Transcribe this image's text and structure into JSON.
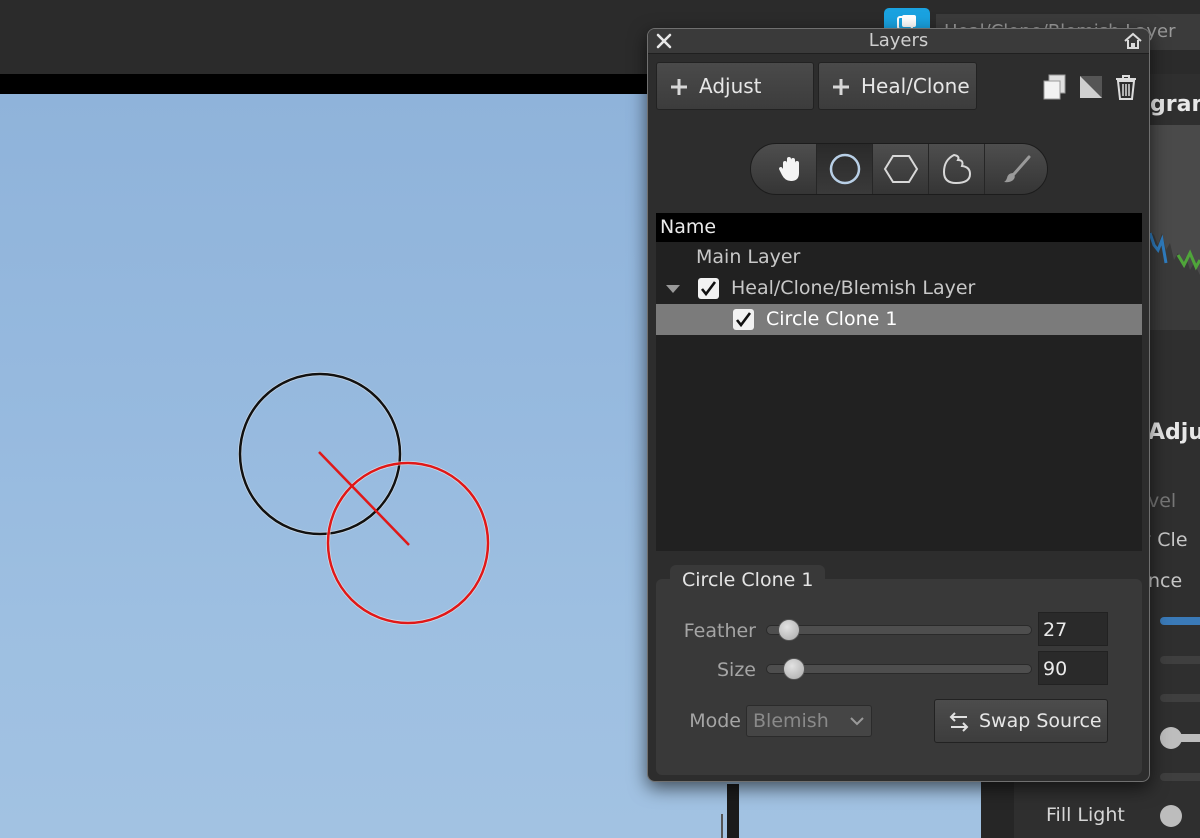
{
  "background": {
    "title_partial": "Heal/Clone/Blemish Layer",
    "histogram_label": "gram",
    "adjust_label": "Adju",
    "side_labels": [
      "vel",
      "y Cle",
      "nce"
    ],
    "fill_light": "Fill Light"
  },
  "window": {
    "title": "Layers",
    "toolbar": {
      "adjust_label": "Adjust",
      "heal_clone_label": "Heal/Clone"
    },
    "tools": [
      "hand-icon",
      "circle-icon",
      "polygon-icon",
      "freehand-icon",
      "brush-icon"
    ],
    "active_tool": "circle-icon",
    "list": {
      "header": "Name",
      "rows": [
        {
          "label": "Main Layer"
        },
        {
          "label": "Heal/Clone/Blemish Layer",
          "checked": true
        },
        {
          "label": "Circle Clone 1",
          "checked": true,
          "selected": true
        }
      ]
    },
    "properties": {
      "title": "Circle Clone 1",
      "feather_label": "Feather",
      "feather_value": "27",
      "feather_fraction": 0.05,
      "size_label": "Size",
      "size_value": "90",
      "size_fraction": 0.07,
      "mode_label": "Mode",
      "mode_value": "Blemish",
      "swap_label": "Swap Source"
    }
  },
  "colors": {
    "sky": "#97badf",
    "source_circle": "#111111",
    "target_circle": "#e01818",
    "sync_blue": "#1aa2e0"
  }
}
